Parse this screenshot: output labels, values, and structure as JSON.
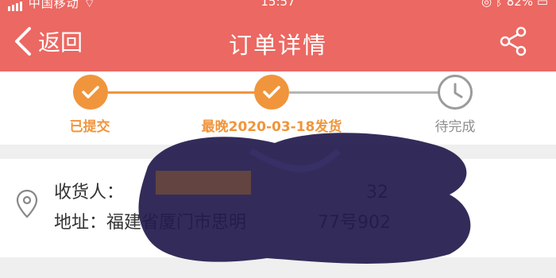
{
  "status_bar": {
    "carrier": "中国移动",
    "time": "15:57",
    "battery": "82%"
  },
  "header": {
    "back_label": "返回",
    "title": "订单详情",
    "share_icon": "share-icon",
    "background": "#ec6862"
  },
  "progress": {
    "steps": [
      {
        "label": "已提交",
        "state": "done"
      },
      {
        "label": "最晚2020-03-18发货",
        "state": "done"
      },
      {
        "label": "待完成",
        "state": "pending"
      }
    ],
    "done_color": "#f0953c",
    "pending_color": "#9b9b9b"
  },
  "address": {
    "icon": "location-pin-icon",
    "recipient_label": "收货人：",
    "recipient_phone_tail": "32",
    "address_label": "地址：",
    "address_visible_start": "福建省厦门市思明",
    "address_visible_end": "77号902"
  }
}
